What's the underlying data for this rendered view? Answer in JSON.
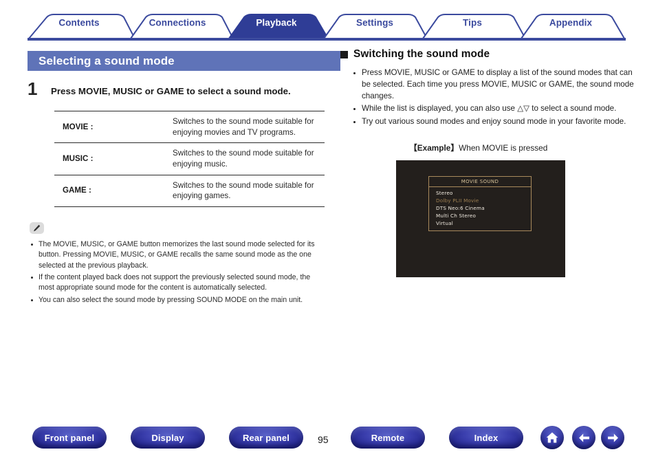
{
  "tabs": [
    {
      "label": "Contents",
      "active": false
    },
    {
      "label": "Connections",
      "active": false
    },
    {
      "label": "Playback",
      "active": true
    },
    {
      "label": "Settings",
      "active": false
    },
    {
      "label": "Tips",
      "active": false
    },
    {
      "label": "Appendix",
      "active": false
    }
  ],
  "left": {
    "section_title": "Selecting a sound mode",
    "step_number": "1",
    "step_text": "Press MOVIE, MUSIC or GAME to select a sound mode.",
    "table": [
      {
        "key": "MOVIE :",
        "value": "Switches to the sound mode suitable for enjoying movies and TV programs."
      },
      {
        "key": "MUSIC :",
        "value": "Switches to the sound mode suitable for enjoying music."
      },
      {
        "key": "GAME :",
        "value": "Switches to the sound mode suitable for enjoying games."
      }
    ],
    "note_icon": "pencil-icon",
    "notes": [
      "The MOVIE, MUSIC, or GAME button memorizes the last sound mode selected for its button. Pressing MOVIE, MUSIC, or GAME recalls the same sound mode as the one selected at the previous playback.",
      "If the content played back does not support the previously selected sound mode, the most appropriate sound mode for the content is automatically selected.",
      "You can also select the sound mode by pressing SOUND MODE on the main unit."
    ]
  },
  "right": {
    "heading": "Switching the sound mode",
    "bullets": [
      "Press MOVIE, MUSIC or GAME to display a list of the sound modes that can be selected. Each time you press MOVIE, MUSIC or GAME, the sound mode changes.",
      "While the list is displayed, you can also use △▽ to select a sound mode.",
      "Try out various sound modes and enjoy sound mode in your favorite mode."
    ],
    "example_label": "【Example】",
    "example_text": "When MOVIE is pressed",
    "osd": {
      "title": "MOVIE SOUND",
      "items": [
        {
          "label": "Stereo",
          "selected": false
        },
        {
          "label": "Dolby PLII Movie",
          "selected": true
        },
        {
          "label": "DTS Neo:6 Cinema",
          "selected": false
        },
        {
          "label": "Multi Ch Stereo",
          "selected": false
        },
        {
          "label": "Virtual",
          "selected": false
        }
      ]
    }
  },
  "footer": {
    "buttons": [
      {
        "label": "Front panel"
      },
      {
        "label": "Display"
      },
      {
        "label": "Rear panel"
      },
      {
        "label": "Remote"
      },
      {
        "label": "Index"
      }
    ],
    "page_number": "95",
    "icons": [
      "home-icon",
      "arrow-left-icon",
      "arrow-right-icon"
    ]
  },
  "colors": {
    "tab_blue": "#3b4a9e",
    "tab_active_fill": "#2f3d96",
    "title_bar": "#5f73b8",
    "osd_gold": "#a98a5c",
    "osd_selected": "#9d7f51"
  }
}
